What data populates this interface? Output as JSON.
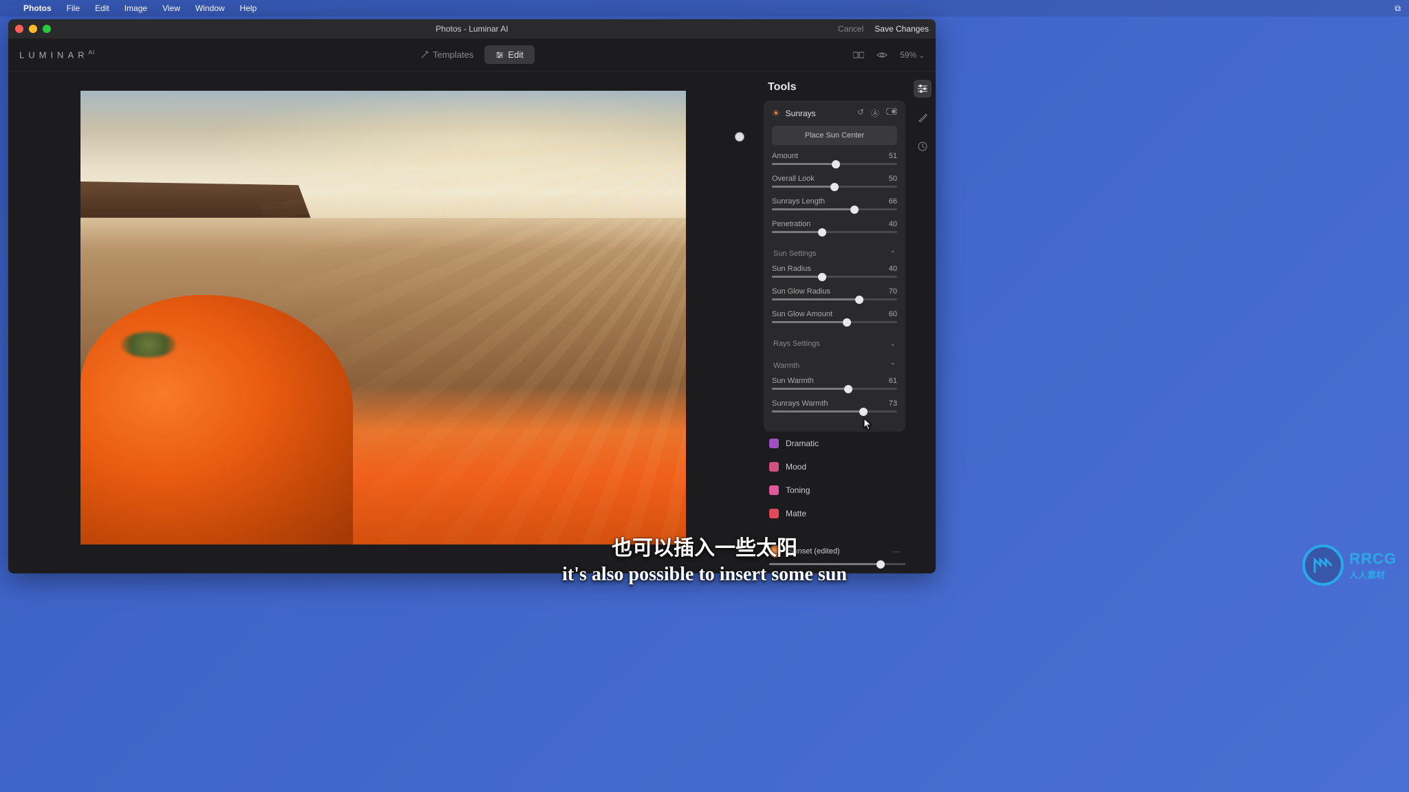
{
  "menubar": {
    "app": "Photos",
    "items": [
      "File",
      "Edit",
      "Image",
      "View",
      "Window",
      "Help"
    ]
  },
  "titlebar": {
    "title": "Photos - Luminar AI",
    "cancel": "Cancel",
    "save": "Save Changes"
  },
  "toolbar": {
    "logo": "LUMINAR",
    "logo_suffix": "AI",
    "templates": "Templates",
    "edit": "Edit",
    "zoom": "59%"
  },
  "tools": {
    "title": "Tools",
    "sunrays": {
      "label": "Sunrays",
      "place_button": "Place Sun Center",
      "sliders": [
        {
          "label": "Amount",
          "value": 51,
          "max": 100
        },
        {
          "label": "Overall Look",
          "value": 50,
          "max": 100
        },
        {
          "label": "Sunrays Length",
          "value": 66,
          "max": 100
        },
        {
          "label": "Penetration",
          "value": 40,
          "max": 100
        }
      ],
      "sun_settings": {
        "label": "Sun Settings",
        "expanded": true,
        "sliders": [
          {
            "label": "Sun Radius",
            "value": 40,
            "max": 100
          },
          {
            "label": "Sun Glow Radius",
            "value": 70,
            "max": 100
          },
          {
            "label": "Sun Glow Amount",
            "value": 60,
            "max": 100
          }
        ]
      },
      "rays_settings": {
        "label": "Rays Settings",
        "expanded": false
      },
      "warmth": {
        "label": "Warmth",
        "expanded": true,
        "sliders": [
          {
            "label": "Sun Warmth",
            "value": 61,
            "max": 100
          },
          {
            "label": "Sunrays Warmth",
            "value": 73,
            "max": 100
          }
        ]
      }
    },
    "other_tools": [
      {
        "name": "Dramatic",
        "color": "#a050c0"
      },
      {
        "name": "Mood",
        "color": "#d05080"
      },
      {
        "name": "Toning",
        "color": "#e05a9a"
      },
      {
        "name": "Matte",
        "color": "#e04a5a"
      }
    ],
    "preset": {
      "label": "Sunset (edited)",
      "value": 82
    }
  },
  "subtitle": {
    "cn": "也可以插入一些太阳",
    "en": "it's also possible to insert some sun"
  },
  "watermark": {
    "text": "RRCG",
    "sub": "人人素材"
  }
}
